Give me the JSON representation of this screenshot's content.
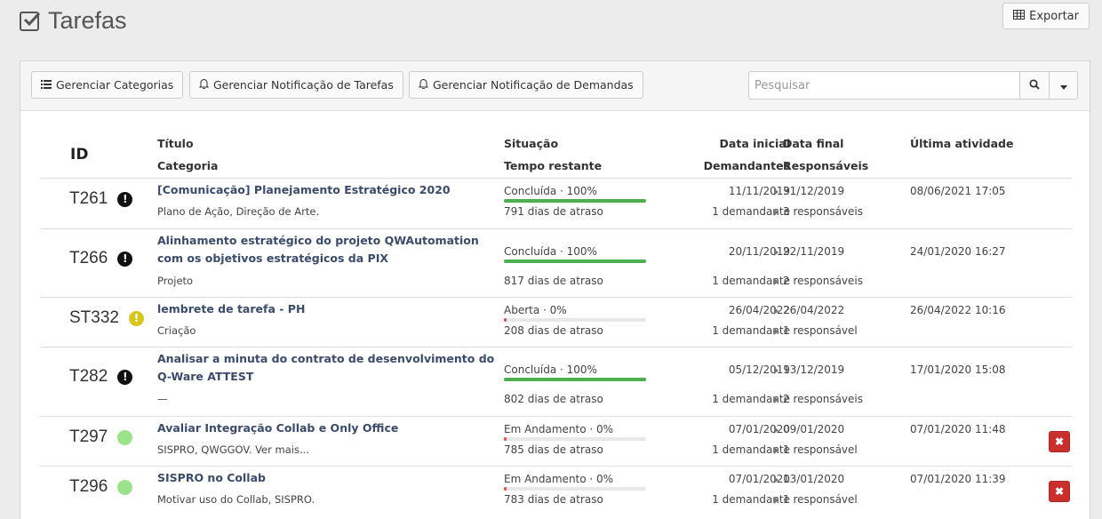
{
  "page": {
    "title": "Tarefas",
    "export_label": "Exportar"
  },
  "toolbar": {
    "manage_categories": "Gerenciar Categorias",
    "manage_task_notif": "Gerenciar Notificação de Tarefas",
    "manage_demand_notif": "Gerenciar Notificação de Demandas",
    "search_placeholder": "Pesquisar"
  },
  "table": {
    "headers": {
      "id": "ID",
      "title": "Título",
      "category": "Categoria",
      "status": "Situação",
      "time_left": "Tempo restante",
      "start": "Data inicial",
      "demanders": "Demandantes",
      "end": "Data final",
      "responsible": "Responsáveis",
      "last": "Última atividade"
    },
    "rows": [
      {
        "id": "T261",
        "priority": "black",
        "title": "[Comunicação] Planejamento Estratégico 2020",
        "category": "Plano de Ação, Direção de Arte.",
        "status": "Concluída · 100%",
        "progress": 100,
        "late": "791 dias de atraso",
        "start": "11/11/2019",
        "end": "31/12/2019",
        "demanders": "1 demandante",
        "responsible": "3 responsáveis",
        "last": "08/06/2021 17:05",
        "deletable": false
      },
      {
        "id": "T266",
        "priority": "black",
        "title": "Alinhamento estratégico do projeto QWAutomation com os objetivos estratégicos da PIX",
        "category": "Projeto",
        "status": "Concluída · 100%",
        "progress": 100,
        "late": "817 dias de atraso",
        "start": "20/11/2019",
        "end": "22/11/2019",
        "demanders": "1 demandante",
        "responsible": "2 responsáveis",
        "last": "24/01/2020 16:27",
        "deletable": false
      },
      {
        "id": "ST332",
        "priority": "yellow",
        "title": "lembrete de tarefa - PH",
        "category": "Criação",
        "status": "Aberta · 0%",
        "progress": 0,
        "late": "208 dias de atraso",
        "start": "26/04/2022",
        "end": "26/04/2022",
        "demanders": "1 demandante",
        "responsible": "1 responsável",
        "last": "26/04/2022 10:16",
        "deletable": false
      },
      {
        "id": "T282",
        "priority": "black",
        "title": "Analisar a minuta do contrato de desenvolvimento do Q-Ware ATTEST",
        "category": "—",
        "status": "Concluída · 100%",
        "progress": 100,
        "late": "802 dias de atraso",
        "start": "05/12/2019",
        "end": "13/12/2019",
        "demanders": "1 demandante",
        "responsible": "2 responsáveis",
        "last": "17/01/2020 15:08",
        "deletable": false
      },
      {
        "id": "T297",
        "priority": "green",
        "title": "Avaliar Integração Collab e Only Office",
        "category": "SISPRO, QWGGOV. Ver mais...",
        "status": "Em Andamento · 0%",
        "progress": 0,
        "late": "785 dias de atraso",
        "start": "07/01/2020",
        "end": "09/01/2020",
        "demanders": "1 demandante",
        "responsible": "1 responsável",
        "last": "07/01/2020 11:48",
        "deletable": true
      },
      {
        "id": "T296",
        "priority": "green",
        "title": "SISPRO no Collab",
        "category": "Motivar uso do Collab, SISPRO.",
        "status": "Em Andamento · 0%",
        "progress": 0,
        "late": "783 dias de atraso",
        "start": "07/01/2020",
        "end": "13/01/2020",
        "demanders": "1 demandante",
        "responsible": "1 responsável",
        "last": "07/01/2020 11:39",
        "deletable": true
      }
    ]
  },
  "colors": {
    "done": "#4caf50",
    "in_progress": "#d9534f",
    "delete": "#c9302c"
  }
}
